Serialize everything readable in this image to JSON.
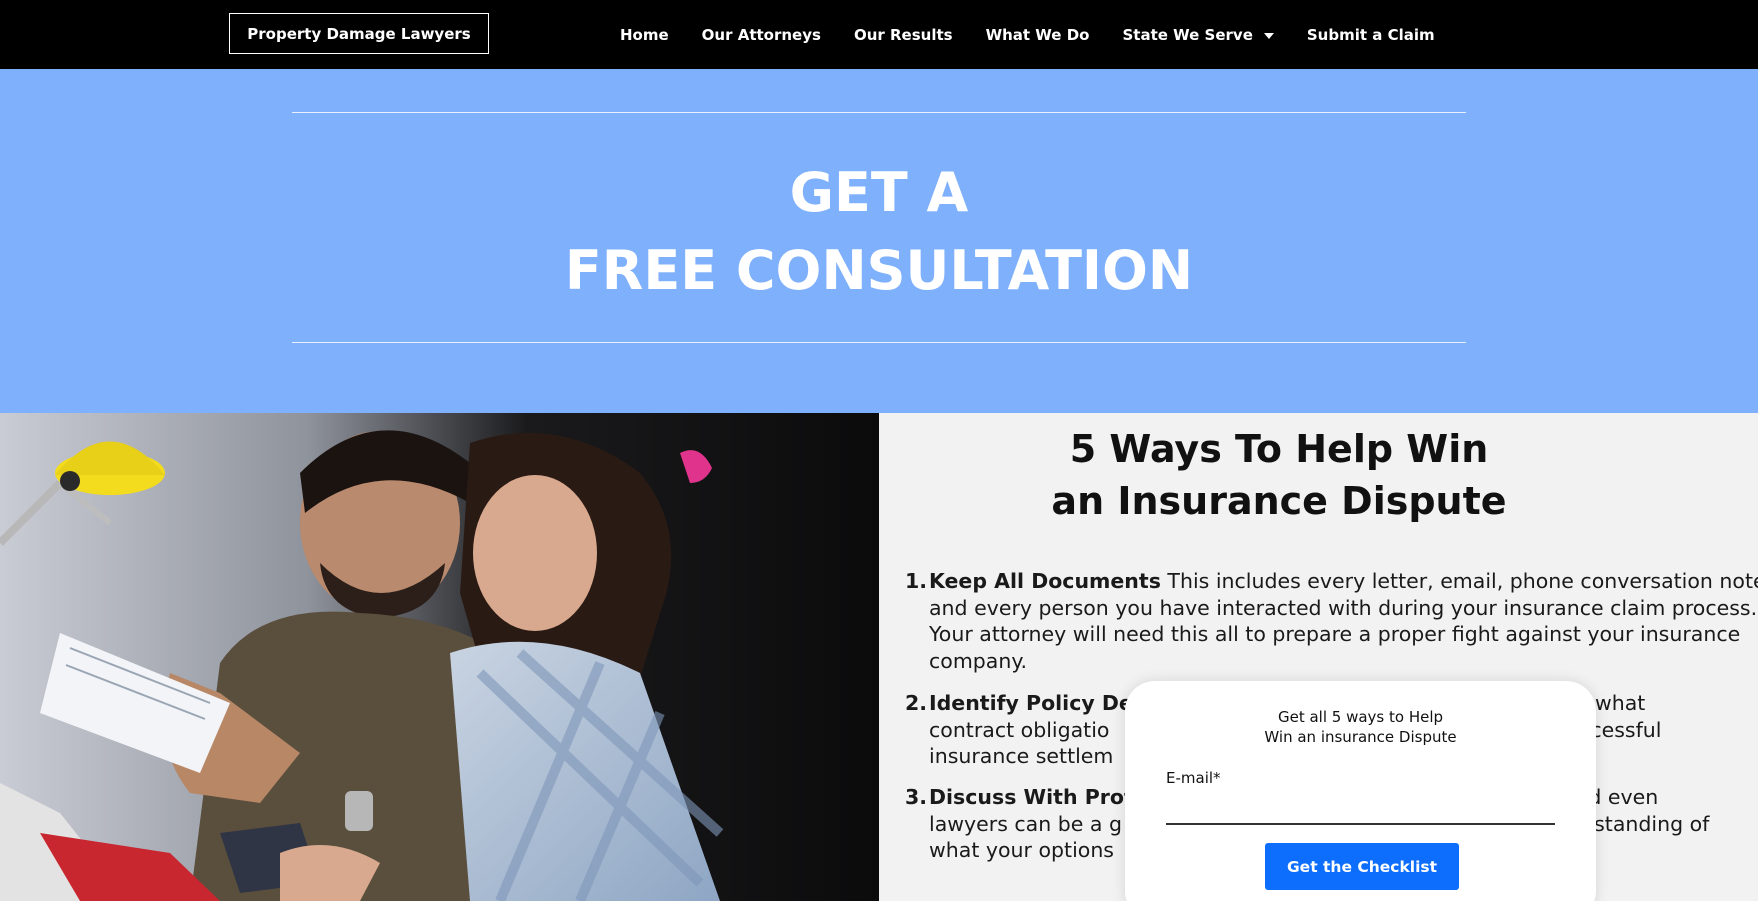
{
  "nav": {
    "brand": "Property Damage Lawyers",
    "links": [
      "Home",
      "Our Attorneys",
      "Our Results",
      "What We Do",
      "State We Serve",
      "Submit a Claim"
    ]
  },
  "hero": {
    "line1": "GET A",
    "line2": "FREE CONSULTATION"
  },
  "section": {
    "title_line1": "5 Ways To Help Win",
    "title_line2": "an Insurance Dispute",
    "items": [
      {
        "num": "1.",
        "heading": "Keep All Documents",
        "line1_rest": " This includes every letter, email, phone conversation notes,",
        "line2": "and every person you have interacted with during your insurance claim process.",
        "line3": "Your attorney will need this all to prepare a proper fight against your insurance",
        "line4": "company."
      },
      {
        "num": "2.",
        "heading": "Identify Policy Det",
        "line1_rest": "",
        "line1_tail": "vers, and what",
        "line2": "contract obligatio",
        "line2_tail": "l to a successful",
        "line3": "insurance settlem"
      },
      {
        "num": "3.",
        "heading": "Discuss With Profe",
        "line1_tail": "ters, and even",
        "line2": "lawyers can be a g",
        "line2_tail": "an understanding of",
        "line3": "what your options"
      }
    ]
  },
  "popup": {
    "line1": "Get all 5 ways to Help",
    "line2": "Win an insurance Dispute",
    "email_label": "E-mail*",
    "email_value": "",
    "button": "Get the Checklist"
  },
  "colors": {
    "nav_bg": "#000000",
    "hero_bg": "#7eb0fc",
    "cta_bg": "#0d6efd"
  },
  "icons": [
    "caret-down-icon"
  ]
}
